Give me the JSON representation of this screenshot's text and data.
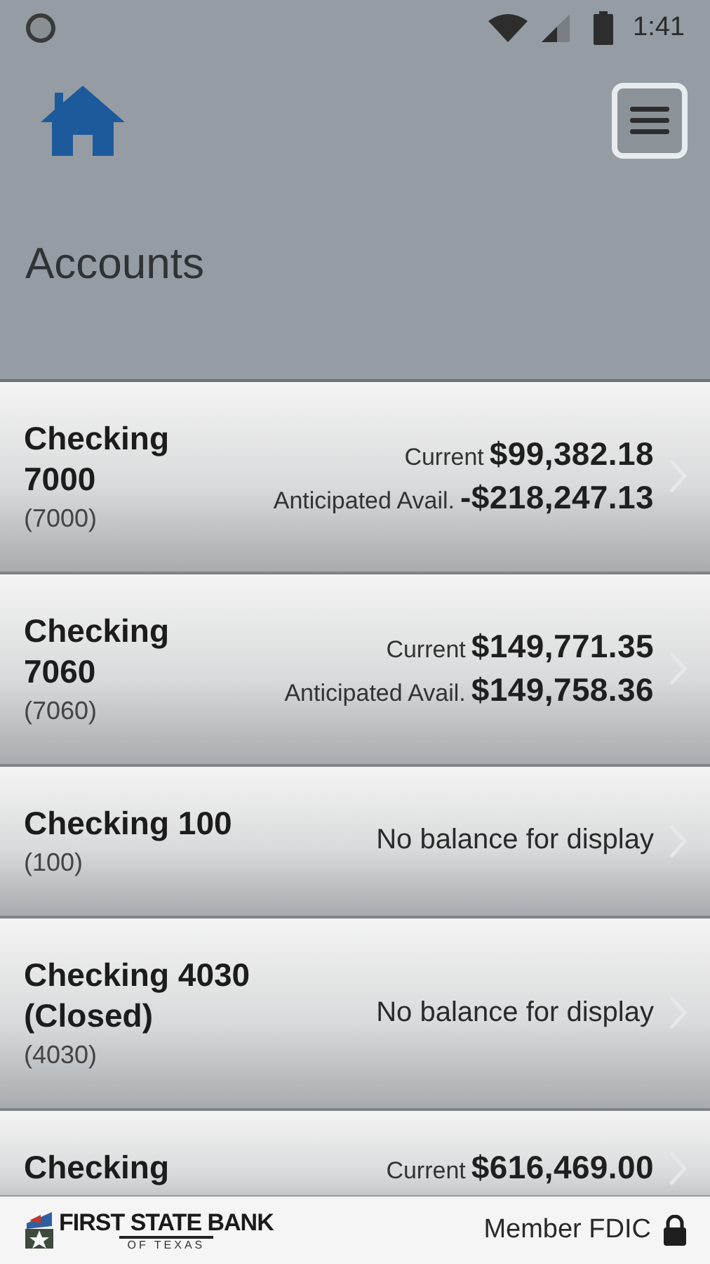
{
  "status_bar": {
    "time": "1:41"
  },
  "header": {
    "title": "Accounts"
  },
  "accounts": [
    {
      "kind": "balances",
      "name": "Checking\n7000",
      "number": "(7000)",
      "balances": [
        {
          "label": "Current",
          "amount": "$99,382.18"
        },
        {
          "label": "Anticipated Avail.",
          "amount": "-$218,247.13"
        }
      ]
    },
    {
      "kind": "balances",
      "name": "Checking\n7060",
      "number": "(7060)",
      "balances": [
        {
          "label": "Current",
          "amount": "$149,771.35"
        },
        {
          "label": "Anticipated Avail.",
          "amount": "$149,758.36"
        }
      ]
    },
    {
      "kind": "message",
      "name": "Checking 100",
      "number": "(100)",
      "message": "No balance for display"
    },
    {
      "kind": "message",
      "name": "Checking 4030\n(Closed)",
      "number": "(4030)",
      "message": "No balance for display"
    },
    {
      "kind": "balances",
      "name": "Checking",
      "balances": [
        {
          "label": "Current",
          "amount": "$616,469.00"
        }
      ]
    }
  ],
  "footer": {
    "bank_name": "FIRST STATE BANK",
    "bank_subtitle": "OF TEXAS",
    "member_text": "Member FDIC"
  }
}
